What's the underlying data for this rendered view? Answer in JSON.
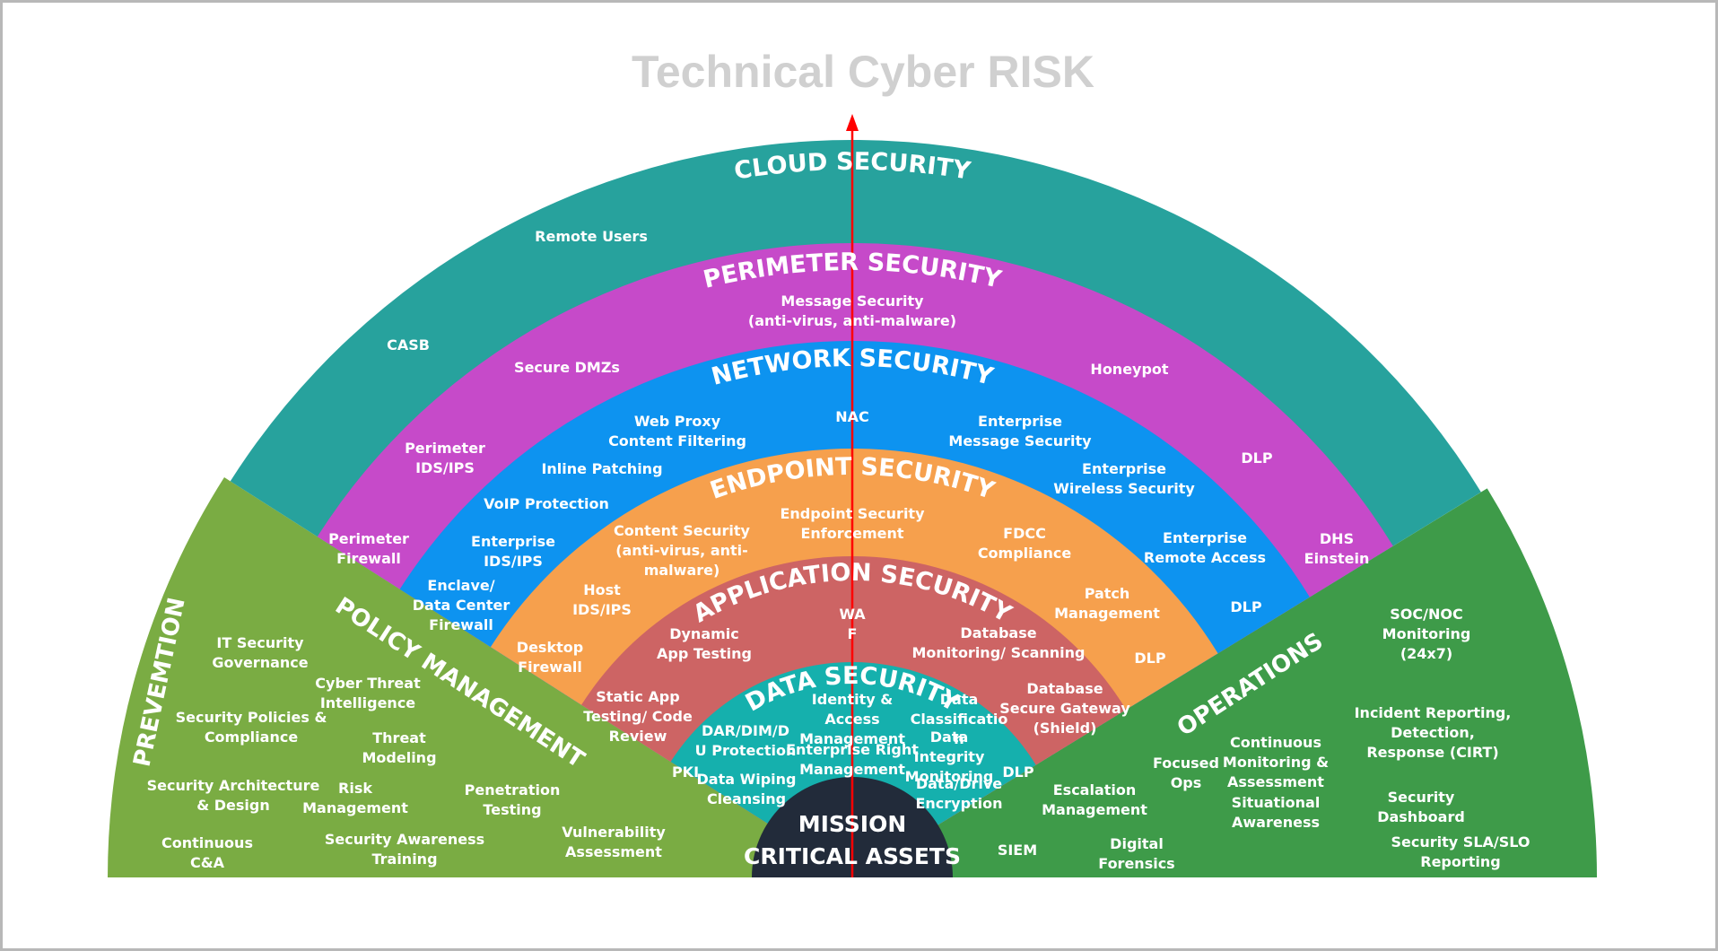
{
  "title": "Technical Cyber RISK",
  "colors": {
    "cloud": "#27a29d",
    "perimeter": "#c64ac9",
    "network": "#0d93f0",
    "endpoint": "#f6a04d",
    "application": "#cd6464",
    "data": "#15b0ad",
    "core": "#222b3a",
    "prevention": "#7aac43",
    "operations": "#3e9b49",
    "arrow": "#ff0000"
  },
  "core": {
    "line1": "MISSION",
    "line2": "CRITICAL ASSETS"
  },
  "rings": [
    {
      "id": "cloud",
      "title": "CLOUD SECURITY",
      "items": [
        [
          "Remote Users"
        ],
        [
          "CASB"
        ]
      ]
    },
    {
      "id": "perimeter",
      "title": "PERIMETER SECURITY",
      "items": [
        [
          "Message Security",
          "(anti-virus, anti-malware)"
        ],
        [
          "Secure DMZs"
        ],
        [
          "Honeypot"
        ],
        [
          "Perimeter",
          "IDS/IPS"
        ],
        [
          "DLP"
        ],
        [
          "Perimeter",
          "Firewall"
        ],
        [
          "DHS",
          "Einstein"
        ]
      ]
    },
    {
      "id": "network",
      "title": "NETWORK SECURITY",
      "items": [
        [
          "Web Proxy",
          "Content Filtering"
        ],
        [
          "NAC"
        ],
        [
          "Enterprise",
          "Message Security"
        ],
        [
          "Inline Patching"
        ],
        [
          "Enterprise",
          "Wireless Security"
        ],
        [
          "VoIP Protection"
        ],
        [
          "Enterprise",
          "IDS/IPS"
        ],
        [
          "Enterprise",
          "Remote Access"
        ],
        [
          "Enclave/",
          "Data Center",
          "Firewall"
        ],
        [
          "DLP"
        ]
      ]
    },
    {
      "id": "endpoint",
      "title": "ENDPOINT SECURITY",
      "items": [
        [
          "Endpoint Security",
          "Enforcement"
        ],
        [
          "Content Security",
          "(anti-virus, anti-",
          "malware)"
        ],
        [
          "FDCC",
          "Compliance"
        ],
        [
          "Host",
          "IDS/IPS"
        ],
        [
          "Patch",
          "Management"
        ],
        [
          "Desktop",
          "Firewall"
        ],
        [
          "DLP"
        ]
      ]
    },
    {
      "id": "application",
      "title": "APPLICATION SECURITY",
      "items": [
        [
          "WA",
          "F"
        ],
        [
          "Dynamic",
          "App Testing"
        ],
        [
          "Database",
          "Monitoring/ Scanning"
        ],
        [
          "Static App",
          "Testing/ Code",
          "Review"
        ],
        [
          "Database",
          "Secure Gateway",
          "(Shield)"
        ]
      ]
    },
    {
      "id": "data",
      "title": "DATA SECURITY",
      "items": [
        [
          "Identity &",
          "Access",
          "Management"
        ],
        [
          "Data",
          "Classificatio",
          "n"
        ],
        [
          "DAR/DIM/D",
          "U Protection"
        ],
        [
          "Enterprise Right",
          "Management"
        ],
        [
          "Data",
          "Integrity",
          "Monitoring"
        ],
        [
          "PKI"
        ],
        [
          "Data Wiping",
          "Cleansing"
        ],
        [
          "Data/Drive",
          "Encryption"
        ],
        [
          "DLP"
        ]
      ]
    }
  ],
  "wedges": {
    "prevention": {
      "label": "PREVEMTION",
      "items": [
        [
          "IT Security",
          "Governance"
        ],
        [
          "Security Policies &",
          "Compliance"
        ],
        [
          "Security Architecture",
          "& Design"
        ],
        [
          "Continuous",
          "C&A"
        ]
      ]
    },
    "policy": {
      "label": "POLICY MANAGEMENT",
      "items": [
        [
          "Cyber Threat",
          "Intelligence"
        ],
        [
          "Threat",
          "Modeling"
        ],
        [
          "Risk",
          "Management"
        ],
        [
          "Penetration",
          "Testing"
        ],
        [
          "Security Awareness",
          "Training"
        ],
        [
          "Vulnerability",
          "Assessment"
        ]
      ]
    },
    "operations": {
      "label": "OPERATIONS",
      "items": [
        [
          "SOC/NOC",
          "Monitoring",
          "(24x7)"
        ],
        [
          "Incident Reporting,",
          "Detection,",
          "Response (CIRT)"
        ],
        [
          "Continuous",
          "Monitoring &",
          "Assessment"
        ],
        [
          "Focused",
          "Ops"
        ],
        [
          "Situational",
          "Awareness"
        ],
        [
          "Security",
          "Dashboard"
        ],
        [
          "Escalation",
          "Management"
        ],
        [
          "Security SLA/SLO",
          "Reporting"
        ],
        [
          "SIEM"
        ],
        [
          "Digital",
          "Forensics"
        ]
      ]
    }
  }
}
